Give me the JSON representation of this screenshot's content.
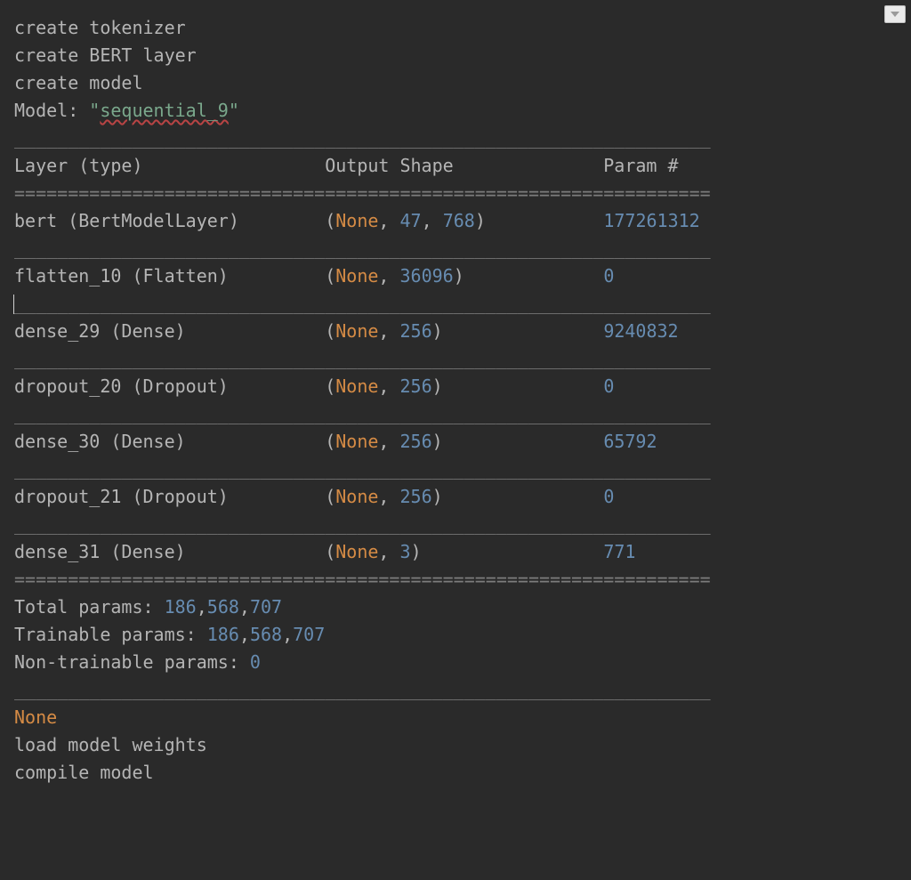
{
  "log": {
    "line1": "create tokenizer",
    "line2": "create BERT layer",
    "line3": "create model",
    "model_label": "Model: ",
    "model_name_quoted_open": "\"",
    "model_name": "sequential_9",
    "model_name_quoted_close": "\""
  },
  "sep": {
    "thin": "_________________________________________________________________",
    "thick": "================================================================="
  },
  "header": {
    "col1": "Layer (type)",
    "col2": "Output Shape",
    "col3": "Param #"
  },
  "rows": [
    {
      "layer": "bert (BertModelLayer)",
      "shape_dims": [
        "None",
        "47",
        "768"
      ],
      "params": "177261312"
    },
    {
      "layer": "flatten_10 (Flatten)",
      "shape_dims": [
        "None",
        "36096"
      ],
      "params": "0"
    },
    {
      "layer": "dense_29 (Dense)",
      "shape_dims": [
        "None",
        "256"
      ],
      "params": "9240832"
    },
    {
      "layer": "dropout_20 (Dropout)",
      "shape_dims": [
        "None",
        "256"
      ],
      "params": "0"
    },
    {
      "layer": "dense_30 (Dense)",
      "shape_dims": [
        "None",
        "256"
      ],
      "params": "65792"
    },
    {
      "layer": "dropout_21 (Dropout)",
      "shape_dims": [
        "None",
        "256"
      ],
      "params": "0"
    },
    {
      "layer": "dense_31 (Dense)",
      "shape_dims": [
        "None",
        "3"
      ],
      "params": "771"
    }
  ],
  "footer": {
    "total_label": "Total params: ",
    "total_value": "186,568,707",
    "trainable_label": "Trainable params: ",
    "trainable_value": "186,568,707",
    "nontrainable_label": "Non-trainable params: ",
    "nontrainable_value": "0"
  },
  "tail": {
    "none": "None",
    "line1": "load model weights",
    "line2": "compile model"
  },
  "cols": {
    "c1": 29,
    "c2": 26
  }
}
